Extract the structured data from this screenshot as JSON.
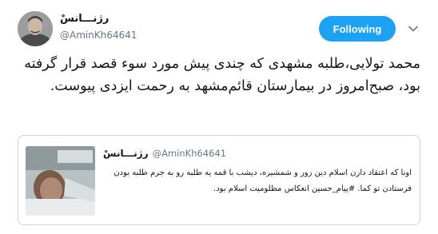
{
  "author": {
    "display_name": "رژنـــانسْ",
    "handle": "@AminKh64641",
    "avatar_icon": "portrait-avatar"
  },
  "follow_button": {
    "label": "Following",
    "color": "#1da1f2"
  },
  "menu": {
    "icon": "chevron-down-icon"
  },
  "tweet": {
    "text": "محمد تولایی،طلبه مشهدی که چندی پیش مورد سوء قصد قرار گرفته بود، صبح‌امروز در بیمارستان قائم‌مشهد به رحمت ایزدی پیوست."
  },
  "quoted_tweet": {
    "display_name": "رژنـــانسْ",
    "handle": "@AminKh64641",
    "text": "اونا که اعتقاد دارن اسلام دین زور و شمشیره، دیشب با قمه یه طلبه رو به جرم طلبه بودن فرستادن تو کما. #پیام_حسین انعکاس مظلومیت اسلام بود.",
    "image_icon": "patient-photo"
  },
  "colors": {
    "text": "#14171a",
    "muted": "#657786",
    "border": "#ccd6dd",
    "accent": "#1da1f2"
  }
}
